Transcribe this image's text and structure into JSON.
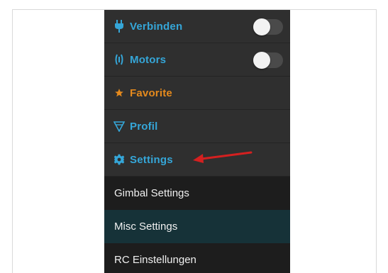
{
  "menu": {
    "items": [
      {
        "label": "Verbinden",
        "icon": "plug-icon",
        "toggle": "off"
      },
      {
        "label": "Motors",
        "icon": "motor-icon",
        "toggle": "off"
      },
      {
        "label": "Favorite",
        "icon": "star-icon"
      },
      {
        "label": "Profil",
        "icon": "profile-triangle-icon"
      },
      {
        "label": "Settings",
        "icon": "gear-icon"
      }
    ],
    "submenu": [
      {
        "label": "Gimbal Settings"
      },
      {
        "label": "Misc Settings",
        "selected": true
      },
      {
        "label": "RC Einstellungen"
      }
    ]
  },
  "colors": {
    "menu_bg": "#2f2f2f",
    "label_blue": "#35a6d8",
    "favorite_orange": "#e58a1d",
    "submenu_bg": "#1d1d1d",
    "submenu_selected_bg": "#163238",
    "arrow_red": "#d42020"
  }
}
